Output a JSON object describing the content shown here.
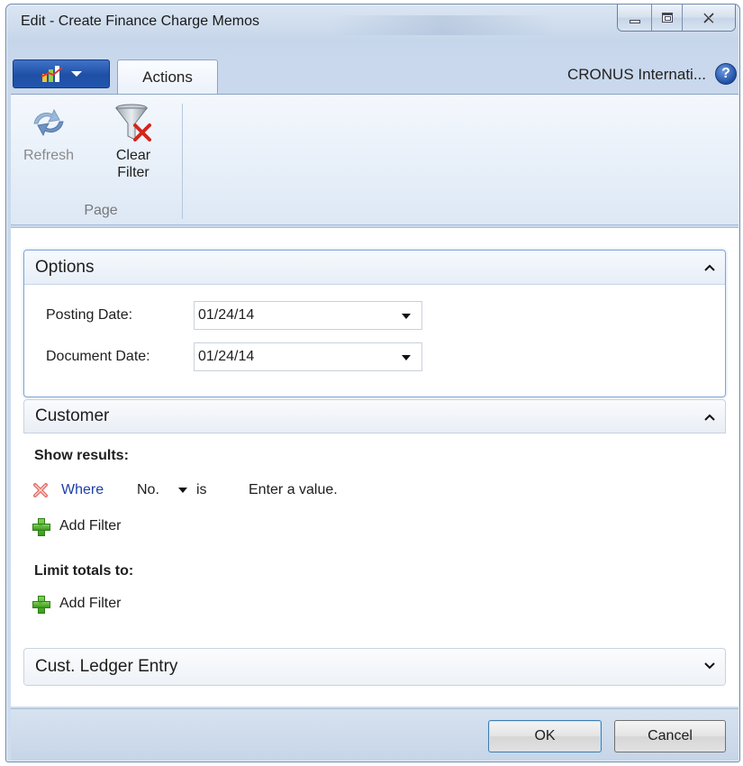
{
  "window": {
    "title": "Edit - Create Finance Charge Memos"
  },
  "ribbon": {
    "tabs": [
      "Actions"
    ],
    "company": "CRONUS Internati...",
    "group": {
      "label": "Page",
      "buttons": [
        {
          "label": "Refresh",
          "enabled": false
        },
        {
          "label": "Clear Filter",
          "line1": "Clear",
          "line2": "Filter",
          "enabled": true
        }
      ]
    }
  },
  "options": {
    "title": "Options",
    "expanded": true,
    "fields": [
      {
        "label": "Posting Date:",
        "value": "01/24/14"
      },
      {
        "label": "Document Date:",
        "value": "01/24/14"
      }
    ]
  },
  "customer": {
    "title": "Customer",
    "expanded": true,
    "show_results_label": "Show results:",
    "filter": {
      "where": "Where",
      "field": "No.",
      "operator": "is",
      "value_placeholder": "Enter a value."
    },
    "add_filter_label": "Add Filter",
    "limit_totals_label": "Limit totals to:",
    "add_filter_label_2": "Add Filter"
  },
  "ledger": {
    "title": "Cust. Ledger Entry",
    "expanded": false
  },
  "footer": {
    "ok_label": "OK",
    "cancel_label": "Cancel"
  },
  "colors": {
    "app_button": "#1f4fa6",
    "link_blue": "#1d3fa6",
    "focus_border": "#7fa6d6"
  }
}
